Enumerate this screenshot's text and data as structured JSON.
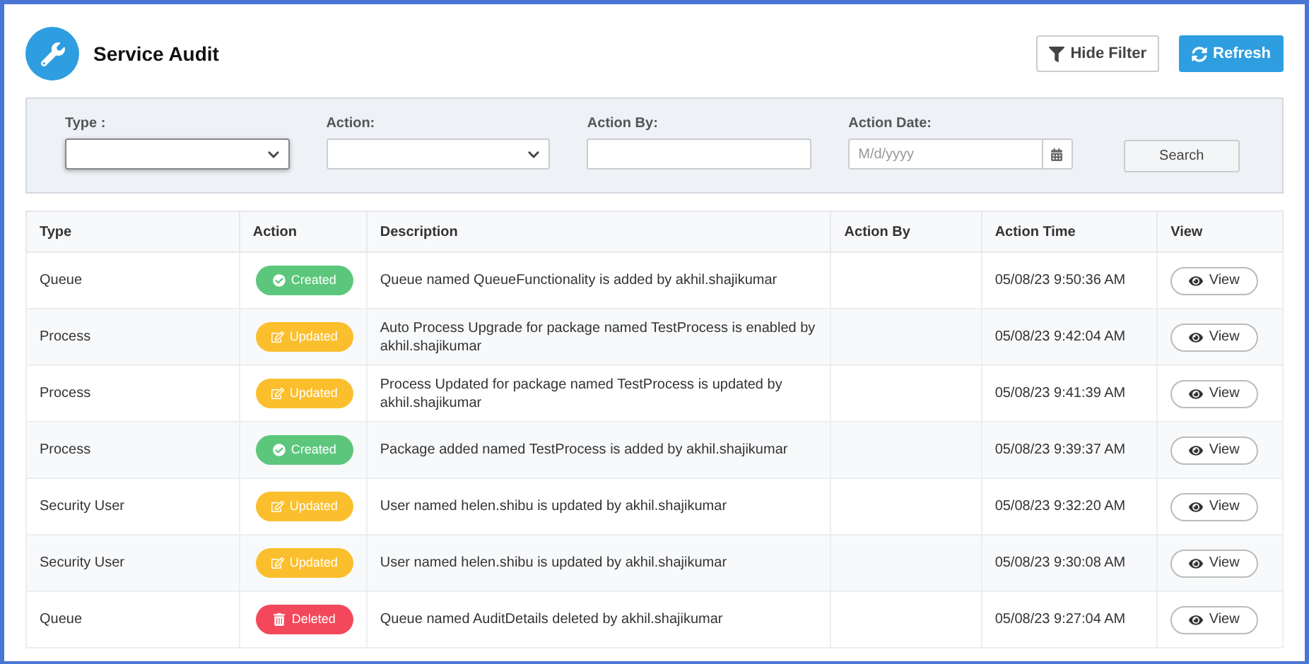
{
  "header": {
    "title": "Service Audit",
    "buttons": [
      {
        "label": "Hide Filter",
        "kind": "filter"
      },
      {
        "label": "Refresh",
        "kind": "refresh"
      }
    ]
  },
  "filters": [
    {
      "label": "Type :",
      "kind": "select",
      "focused": true
    },
    {
      "label": "Action:",
      "kind": "select",
      "focused": false
    },
    {
      "label": "Action By:",
      "kind": "text",
      "focused": false
    },
    {
      "label": "Action Date:",
      "kind": "date",
      "placeholder": "M/d/yyyy",
      "focused": false
    }
  ],
  "search_button": "Search",
  "table": {
    "columns": [
      "Type",
      "Action",
      "Description",
      "Action By",
      "Action Time",
      "View"
    ],
    "rows": [
      {
        "type": "Queue",
        "action": {
          "label": "Created",
          "kind": "created"
        },
        "description": "Queue named QueueFunctionality is added by akhil.shajikumar",
        "time": "05/08/23 9:50:36 AM",
        "view": "View"
      },
      {
        "type": "Process",
        "action": {
          "label": "Updated",
          "kind": "updated"
        },
        "description": "Auto Process Upgrade for package named TestProcess is enabled by akhil.shajikumar",
        "time": "05/08/23 9:42:04 AM",
        "view": "View"
      },
      {
        "type": "Process",
        "action": {
          "label": "Updated",
          "kind": "updated"
        },
        "description": "Process Updated for package named TestProcess is updated by akhil.shajikumar",
        "time": "05/08/23 9:41:39 AM",
        "view": "View"
      },
      {
        "type": "Process",
        "action": {
          "label": "Created",
          "kind": "created"
        },
        "description": "Package added named TestProcess is added by akhil.shajikumar",
        "time": "05/08/23 9:39:37 AM",
        "view": "View"
      },
      {
        "type": "Security User",
        "action": {
          "label": "Updated",
          "kind": "updated"
        },
        "description": "User named helen.shibu is updated by akhil.shajikumar",
        "time": "05/08/23 9:32:20 AM",
        "view": "View"
      },
      {
        "type": "Security User",
        "action": {
          "label": "Updated",
          "kind": "updated"
        },
        "description": "User named helen.shibu is updated by akhil.shajikumar",
        "time": "05/08/23 9:30:08 AM",
        "view": "View"
      },
      {
        "type": "Queue",
        "action": {
          "label": "Deleted",
          "kind": "deleted"
        },
        "description": "Queue named AuditDetails deleted by akhil.shajikumar",
        "time": "05/08/23 9:27:04 AM",
        "view": "View"
      }
    ]
  }
}
